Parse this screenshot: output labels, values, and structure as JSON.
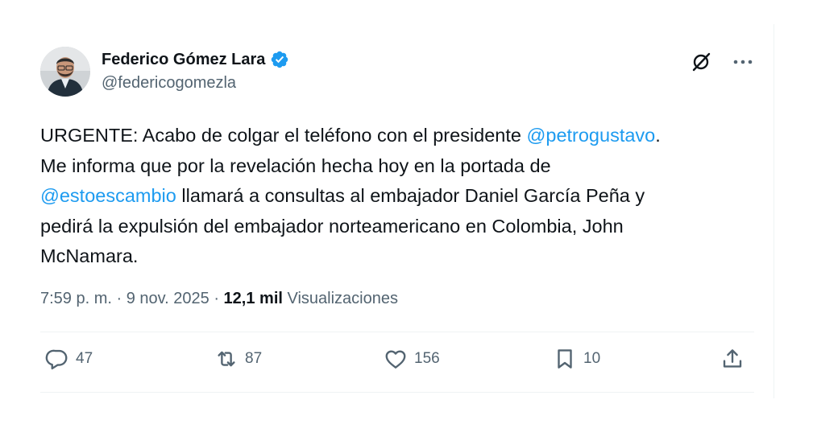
{
  "author": {
    "display_name": "Federico Gómez Lara",
    "handle": "@federicogomezla"
  },
  "tweet": {
    "segments": [
      {
        "text": "URGENTE: Acabo de colgar el teléfono con el presidente ",
        "mention": false
      },
      {
        "text": "@petrogustavo",
        "mention": true
      },
      {
        "text": ".\nMe informa que por la revelación hecha hoy en la portada de\n",
        "mention": false
      },
      {
        "text": "@estoescambio",
        "mention": true
      },
      {
        "text": " llamará a consultas al embajador Daniel García Peña y\npedirá la expulsión del embajador norteamericano en Colombia, John\nMcNamara.",
        "mention": false
      }
    ]
  },
  "meta": {
    "time": "7:59 p. m.",
    "separator": " · ",
    "date": "9 nov. 2025",
    "separator2": " · ",
    "views_count": "12,1 mil",
    "views_label": " Visualizaciones"
  },
  "stats": {
    "replies": "47",
    "reposts": "87",
    "likes": "156",
    "bookmarks": "10"
  },
  "icons": {
    "verified": "verified-badge-icon",
    "grok": "grok-icon",
    "more": "more-icon",
    "reply": "reply-icon",
    "repost": "repost-icon",
    "like": "like-icon",
    "bookmark": "bookmark-icon",
    "share": "share-icon"
  },
  "colors": {
    "accent": "#1d9bf0",
    "text": "#0f1419",
    "secondary": "#536471"
  }
}
